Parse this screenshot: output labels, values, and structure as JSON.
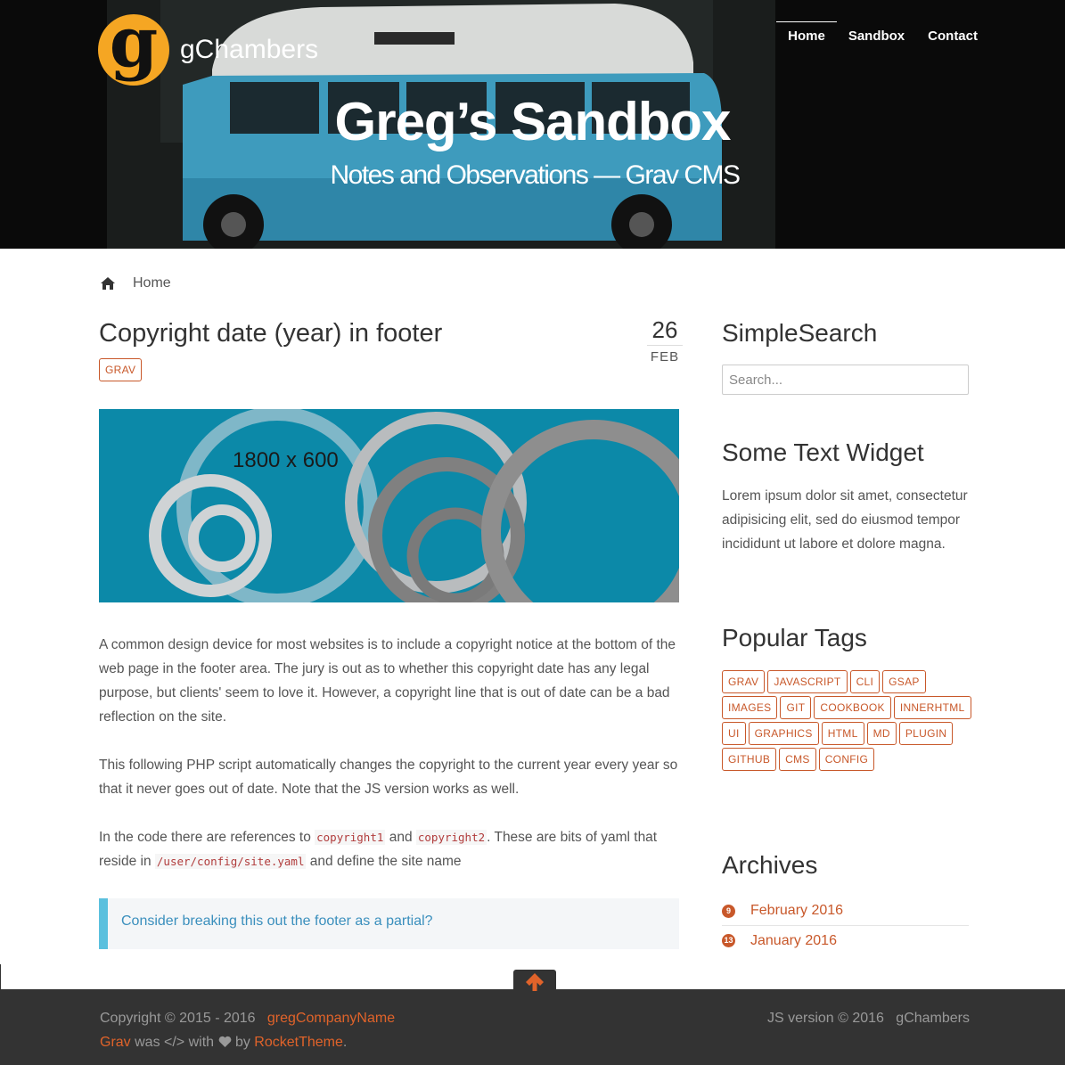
{
  "brand": {
    "logo_letter": "g",
    "name": "gChambers"
  },
  "nav": [
    {
      "label": "Home",
      "active": true
    },
    {
      "label": "Sandbox",
      "active": false
    },
    {
      "label": "Contact",
      "active": false
    }
  ],
  "hero": {
    "title": "Greg’s Sandbox",
    "subtitle": "Notes and Observations — Grav CMS"
  },
  "breadcrumb": {
    "icon": "home-icon",
    "label": "Home"
  },
  "post": {
    "title": "Copyright date (year) in footer",
    "date_day": "26",
    "date_month": "FEB",
    "tag": "GRAV",
    "image_label": "1800 x 600",
    "para1": "A common design device for most websites is to include a copyright notice at the bottom of the web page in the footer area. The jury is out as to whether this copyright date has any legal purpose, but clients' seem to love it. However, a copyright line that is out of date can be a bad reflection on the site.",
    "para2": "This following PHP script automatically changes the copyright to the current year every year so that it never goes out of date. Note that the JS version works as well.",
    "para3_a": "In the code there are references to ",
    "code1": "copyright1",
    "para3_b": " and ",
    "code2": "copyright2",
    "para3_c": ". These are bits of yaml that reside in ",
    "code3": "/user/config/site.yaml",
    "para3_d": " and define the site name",
    "callout": "Consider breaking this out the footer as a partial?"
  },
  "sidebar": {
    "search_heading": "SimpleSearch",
    "search_placeholder": "Search...",
    "text_widget_heading": "Some Text Widget",
    "text_widget_body": "Lorem ipsum dolor sit amet, consectetur adipisicing elit, sed do eiusmod tempor incididunt ut labore et dolore magna.",
    "tags_heading": "Popular Tags",
    "tags": [
      "GRAV",
      "JAVASCRIPT",
      "CLI",
      "GSAP",
      "IMAGES",
      "GIT",
      "COOKBOOK",
      "INNERHTML",
      "UI",
      "GRAPHICS",
      "HTML",
      "MD",
      "PLUGIN",
      "GITHUB",
      "CMS",
      "CONFIG"
    ],
    "archives_heading": "Archives",
    "archives": [
      {
        "count": "9",
        "label": "February 2016"
      },
      {
        "count": "13",
        "label": "January 2016"
      }
    ]
  },
  "footer": {
    "copyright": "Copyright © 2015 - 2016",
    "company": "gregCompanyName",
    "grav": "Grav",
    "was": " was ",
    "code_glyph": "</>",
    "with": " with ",
    "by": " by ",
    "rockettheme": "RocketTheme",
    "period": ".",
    "js_version": "JS version © 2016",
    "author": "gChambers"
  },
  "colors": {
    "accent": "#c8582a",
    "callout_border": "#5bc0de",
    "logo": "#f5a623",
    "footer_bg": "#333333"
  }
}
